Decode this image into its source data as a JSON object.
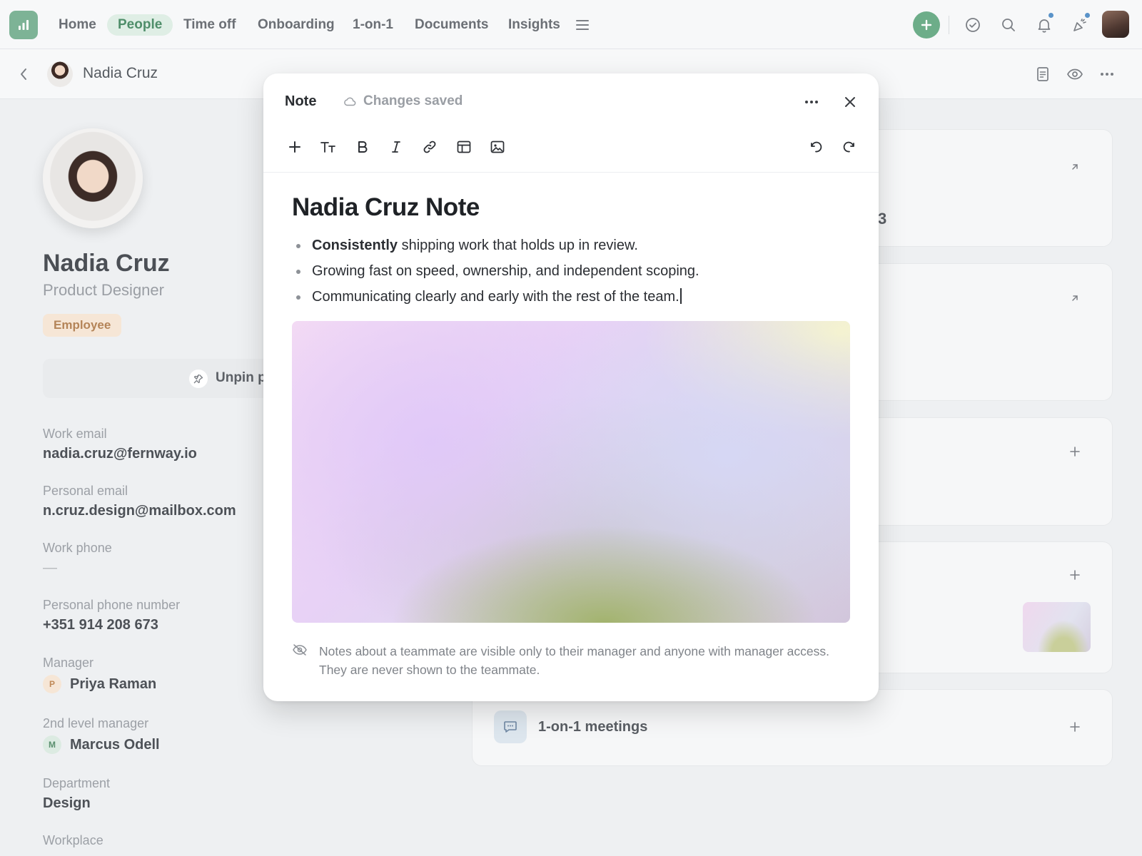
{
  "nav": {
    "items": [
      {
        "label": "Home",
        "active": false
      },
      {
        "label": "People",
        "active": true
      },
      {
        "label": "Time off",
        "active": false
      },
      {
        "label": "Onboarding",
        "active": false
      },
      {
        "label": "1-on-1",
        "active": false
      },
      {
        "label": "Documents",
        "active": false
      },
      {
        "label": "Insights",
        "active": false
      }
    ],
    "icons": [
      "menu-icon",
      "plus-icon",
      "check-circle-icon",
      "search-icon",
      "bell-icon",
      "party-popper-icon",
      "user-avatar"
    ],
    "accent": "#55a076"
  },
  "subheader": {
    "name": "Nadia Cruz",
    "icons": [
      "back-icon",
      "document-icon",
      "eye-icon",
      "more-icon"
    ]
  },
  "profile": {
    "name": "Nadia Cruz",
    "role": "Product Designer",
    "badge": "Employee",
    "unpin_label": "Unpin p",
    "fields": [
      {
        "label": "Work email",
        "value": "nadia.cruz@fernway.io"
      },
      {
        "label": "Personal email",
        "value": "n.cruz.design@mailbox.com"
      },
      {
        "label": "Work phone",
        "value": "—"
      },
      {
        "label": "Personal phone number",
        "value": "+351 914 208 673"
      },
      {
        "label": "Manager",
        "value": "Priya Raman",
        "initial": "P"
      },
      {
        "label": "2nd level manager",
        "value": "Marcus Odell",
        "initial": "M"
      },
      {
        "label": "Department",
        "value": "Design"
      },
      {
        "label": "Workplace",
        "value": ""
      }
    ]
  },
  "cards": {
    "fragment": "3",
    "meetings_label": "1-on-1 meetings"
  },
  "modal": {
    "title": "Note",
    "status": "Changes saved",
    "toolbar": [
      "add-icon",
      "text-size-icon",
      "bold-icon",
      "italic-icon",
      "link-icon",
      "table-icon",
      "image-icon",
      "undo-icon",
      "redo-icon"
    ],
    "doc_title": "Nadia Cruz Note",
    "bullets": [
      {
        "bold": "Consistently",
        "text": " shipping work that holds up in review."
      },
      {
        "bold": "",
        "text": "Growing fast on speed, ownership, and independent scoping."
      },
      {
        "bold": "",
        "text": "Communicating clearly and early with the rest of the team."
      }
    ],
    "hint_line1": "Notes about a teammate are visible only to their manager and anyone with manager access.",
    "hint_line2": "They are never shown to the teammate."
  }
}
